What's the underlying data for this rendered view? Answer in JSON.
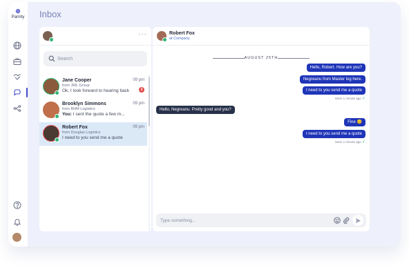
{
  "app": {
    "logo_mark": "⊕",
    "logo_text": "Parnity",
    "page_title": "Inbox"
  },
  "search": {
    "placeholder": "Search"
  },
  "conversations": [
    {
      "name": "Jane Cooper",
      "org": "from JML Group",
      "preview_prefix": "",
      "preview": "Ok, I look forward to hearing back",
      "time": "09 pm",
      "unread": "2",
      "avatar_color": "#8a5a3c"
    },
    {
      "name": "Brooklyn Simmons",
      "org": "from BHM Logistics",
      "preview_prefix": "You:",
      "preview": " I sent the quote a few m...",
      "time": "09 pm",
      "unread": "",
      "avatar_color": "#c0704a"
    },
    {
      "name": "Robert Fox",
      "org": "from Douglas Logistics",
      "preview_prefix": "",
      "preview": "I need to you send me a quote",
      "time": "09 pm",
      "unread": "",
      "avatar_color": "#4a3a32"
    }
  ],
  "chat": {
    "contact_name": "Robert Fox",
    "contact_company": "at Company",
    "date_label": "AUGUST 25TH",
    "messages": [
      {
        "direction": "out",
        "text": "Hello, Robert. How are you?"
      },
      {
        "direction": "out",
        "text": "Negreanu from Master log here."
      },
      {
        "direction": "out",
        "text": "I need to you send me a quote"
      },
      {
        "direction": "seen",
        "text": "Seen 1 minute ago"
      },
      {
        "direction": "in",
        "text": "Hello, Negreanu. Pretty good and you?"
      },
      {
        "direction": "out",
        "text": "Fine 😊"
      },
      {
        "direction": "out",
        "text": "I need to you send me a quote"
      },
      {
        "direction": "seen",
        "text": "Seen 1 minute ago"
      }
    ],
    "composer_placeholder": "Type something..."
  },
  "icons": {
    "sidebar": [
      "globe-icon",
      "briefcase-icon",
      "handshake-icon",
      "chat-icon",
      "network-icon",
      "help-icon",
      "bell-icon"
    ],
    "composer": [
      "emoji-icon",
      "paperclip-icon",
      "send-icon"
    ]
  },
  "colors": {
    "accent": "#1f35b8",
    "online": "#2fb574",
    "badge": "#e04848",
    "active_row": "#dbe9f7"
  }
}
